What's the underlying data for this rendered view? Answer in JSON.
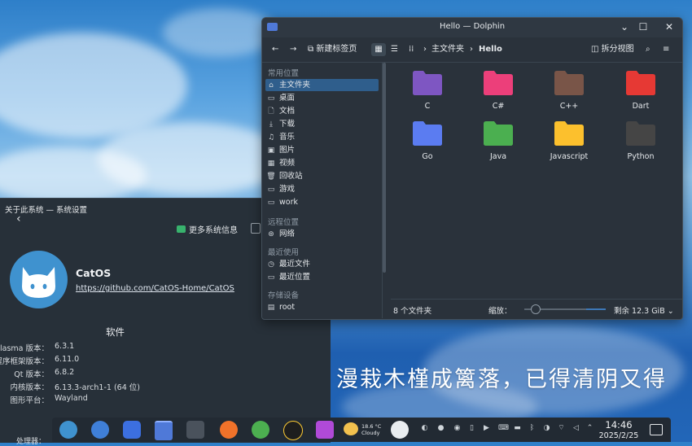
{
  "wallpaper": {
    "poem": "漫栽木槿成篱落，已得清阴又得"
  },
  "settings": {
    "title": "关于此系统 — 系统设置",
    "more_info": "更多系统信息",
    "os_name": "CatOS",
    "os_url": "https://github.com/CatOS-Home/CatOS",
    "section_title": "软件",
    "rows": [
      {
        "key": "Plasma 版本：",
        "value": "6.3.1"
      },
      {
        "key": "KDE 程序框架版本：",
        "value": "6.11.0"
      },
      {
        "key": "Qt 版本：",
        "value": "6.8.2"
      },
      {
        "key": "内核版本：",
        "value": "6.13.3-arch1-1 (64 位)"
      },
      {
        "key": "图形平台：",
        "value": "Wayland"
      }
    ],
    "cutoff_label": "处理器："
  },
  "dolphin": {
    "title": "Hello — Dolphin",
    "toolbar": {
      "new_tab": "新建标签页",
      "split_view": "拆分视图"
    },
    "breadcrumb": [
      "主文件夹",
      "Hello"
    ],
    "sidebar": {
      "sections": [
        {
          "title": "常用位置",
          "items": [
            {
              "label": "主文件夹",
              "icon": "home-icon",
              "glyph": "⌂"
            },
            {
              "label": "桌面",
              "icon": "desktop-icon",
              "glyph": "▭"
            },
            {
              "label": "文档",
              "icon": "document-icon",
              "glyph": "🗋"
            },
            {
              "label": "下载",
              "icon": "download-icon",
              "glyph": "⤓"
            },
            {
              "label": "音乐",
              "icon": "music-icon",
              "glyph": "♫"
            },
            {
              "label": "图片",
              "icon": "image-icon",
              "glyph": "▣"
            },
            {
              "label": "视频",
              "icon": "video-icon",
              "glyph": "▦"
            },
            {
              "label": "回收站",
              "icon": "trash-icon",
              "glyph": "🗑"
            },
            {
              "label": "游戏",
              "icon": "folder-icon",
              "glyph": "▭"
            },
            {
              "label": "work",
              "icon": "folder-icon",
              "glyph": "▭"
            }
          ]
        },
        {
          "title": "远程位置",
          "items": [
            {
              "label": "网络",
              "icon": "network-icon",
              "glyph": "⊛"
            }
          ]
        },
        {
          "title": "最近使用",
          "items": [
            {
              "label": "最近文件",
              "icon": "recent-files-icon",
              "glyph": "◷"
            },
            {
              "label": "最近位置",
              "icon": "recent-locations-icon",
              "glyph": "▭"
            }
          ]
        },
        {
          "title": "存储设备",
          "items": [
            {
              "label": "root",
              "icon": "drive-icon",
              "glyph": "▤"
            }
          ]
        }
      ]
    },
    "folders": [
      {
        "name": "C",
        "color": "#7e57c2"
      },
      {
        "name": "C#",
        "color": "#ec407a"
      },
      {
        "name": "C++",
        "color": "#795548"
      },
      {
        "name": "Dart",
        "color": "#e53935"
      },
      {
        "name": "Go",
        "color": "#5b7cf0"
      },
      {
        "name": "Java",
        "color": "#4caf50"
      },
      {
        "name": "Javascript",
        "color": "#fbc02d"
      },
      {
        "name": "Python",
        "color": "#454545"
      }
    ],
    "status": {
      "count": "8 个文件夹",
      "zoom_label": "缩放：",
      "free": "剩余 12.3 GiB"
    }
  },
  "taskbar": {
    "weather": {
      "temp": "18.6 °C",
      "desc": "Cloudy"
    },
    "time": "14:46",
    "date": "2025/2/25",
    "apps": [
      {
        "name": "catos-launcher-icon",
        "color": "#3f92cf"
      },
      {
        "name": "toggle-app-icon",
        "color": "#3f7fd8"
      },
      {
        "name": "store-app-icon",
        "color": "#3c6fe0"
      },
      {
        "name": "dolphin-app-icon",
        "color": "#4f79d8"
      },
      {
        "name": "terminal-app-icon",
        "color": "#4a525c"
      },
      {
        "name": "firefox-app-icon",
        "color": "#f0722a"
      },
      {
        "name": "chrome-app-icon",
        "color": "#4caf50"
      },
      {
        "name": "qq-app-icon",
        "color": "#1e1e1e"
      },
      {
        "name": "screenshot-app-icon",
        "color": "#b04ad8"
      }
    ]
  }
}
